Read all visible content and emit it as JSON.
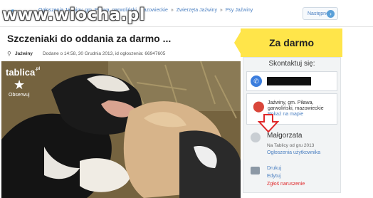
{
  "watermark": {
    "text": "www.wiocha.pl"
  },
  "nav": {
    "breadcrumbs": [
      "Ogłoszenia Jaźwiny, gm. Piława, garwoliński, mazowieckie",
      "Zwierzęta Jaźwiny",
      "Psy Jaźwiny"
    ],
    "separator": "»",
    "next_label": "Następne"
  },
  "listing": {
    "title": "Szczeniaki do oddania za darmo ...",
    "location": "Jaźwiny",
    "meta": "Dodane o 14:58, 30 Grudnia 2013, id ogłoszenia: 66947605"
  },
  "photo": {
    "brand": "tablica",
    "brand_suffix": ".pl",
    "observe_label": "Obserwuj"
  },
  "sidebar": {
    "price": "Za darmo",
    "contact_label": "Skontaktuj się:",
    "address_line1": "Jaźwiny, gm. Piława,",
    "address_line2": "garwoliński, mazowieckie",
    "show_map": "Pokaż na mapie",
    "user_name": "Małgorzata",
    "member_since": "Na Tablicy od gru 2013",
    "user_ads": "Ogłoszenia użytkownika",
    "print": "Drukuj",
    "edit": "Edytuj",
    "report": "Zgłoś naruszenie"
  },
  "colors": {
    "accent": "#ffe54a",
    "link": "#4a7fc1",
    "alert": "#e0292b"
  },
  "icons": [
    "chevron-left-icon",
    "chevron-right-icon",
    "location-pin-icon",
    "star-icon",
    "phone-icon",
    "map-pin-icon",
    "user-icon",
    "print-icon",
    "red-arrow-down-icon"
  ]
}
